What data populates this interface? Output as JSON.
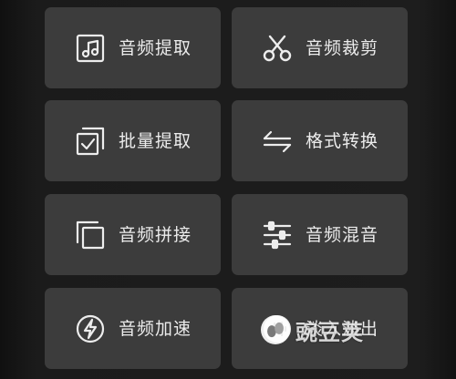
{
  "tools": [
    {
      "label": "音频提取",
      "icon": "music-file-icon"
    },
    {
      "label": "音频裁剪",
      "icon": "scissors-icon"
    },
    {
      "label": "批量提取",
      "icon": "batch-select-icon"
    },
    {
      "label": "格式转换",
      "icon": "convert-arrows-icon"
    },
    {
      "label": "音频拼接",
      "icon": "stacked-squares-icon"
    },
    {
      "label": "音频混音",
      "icon": "mixer-sliders-icon"
    },
    {
      "label": "音频加速",
      "icon": "lightning-circle-icon"
    },
    {
      "label": "淡入淡出",
      "icon": "waveform-circle-icon"
    }
  ],
  "watermark": {
    "text": "豌豆荚",
    "icon": "wandoujia-logo-icon"
  },
  "colors": {
    "background": "#1b1b1b",
    "tile": "#3c3c3c",
    "text": "#ececec"
  }
}
